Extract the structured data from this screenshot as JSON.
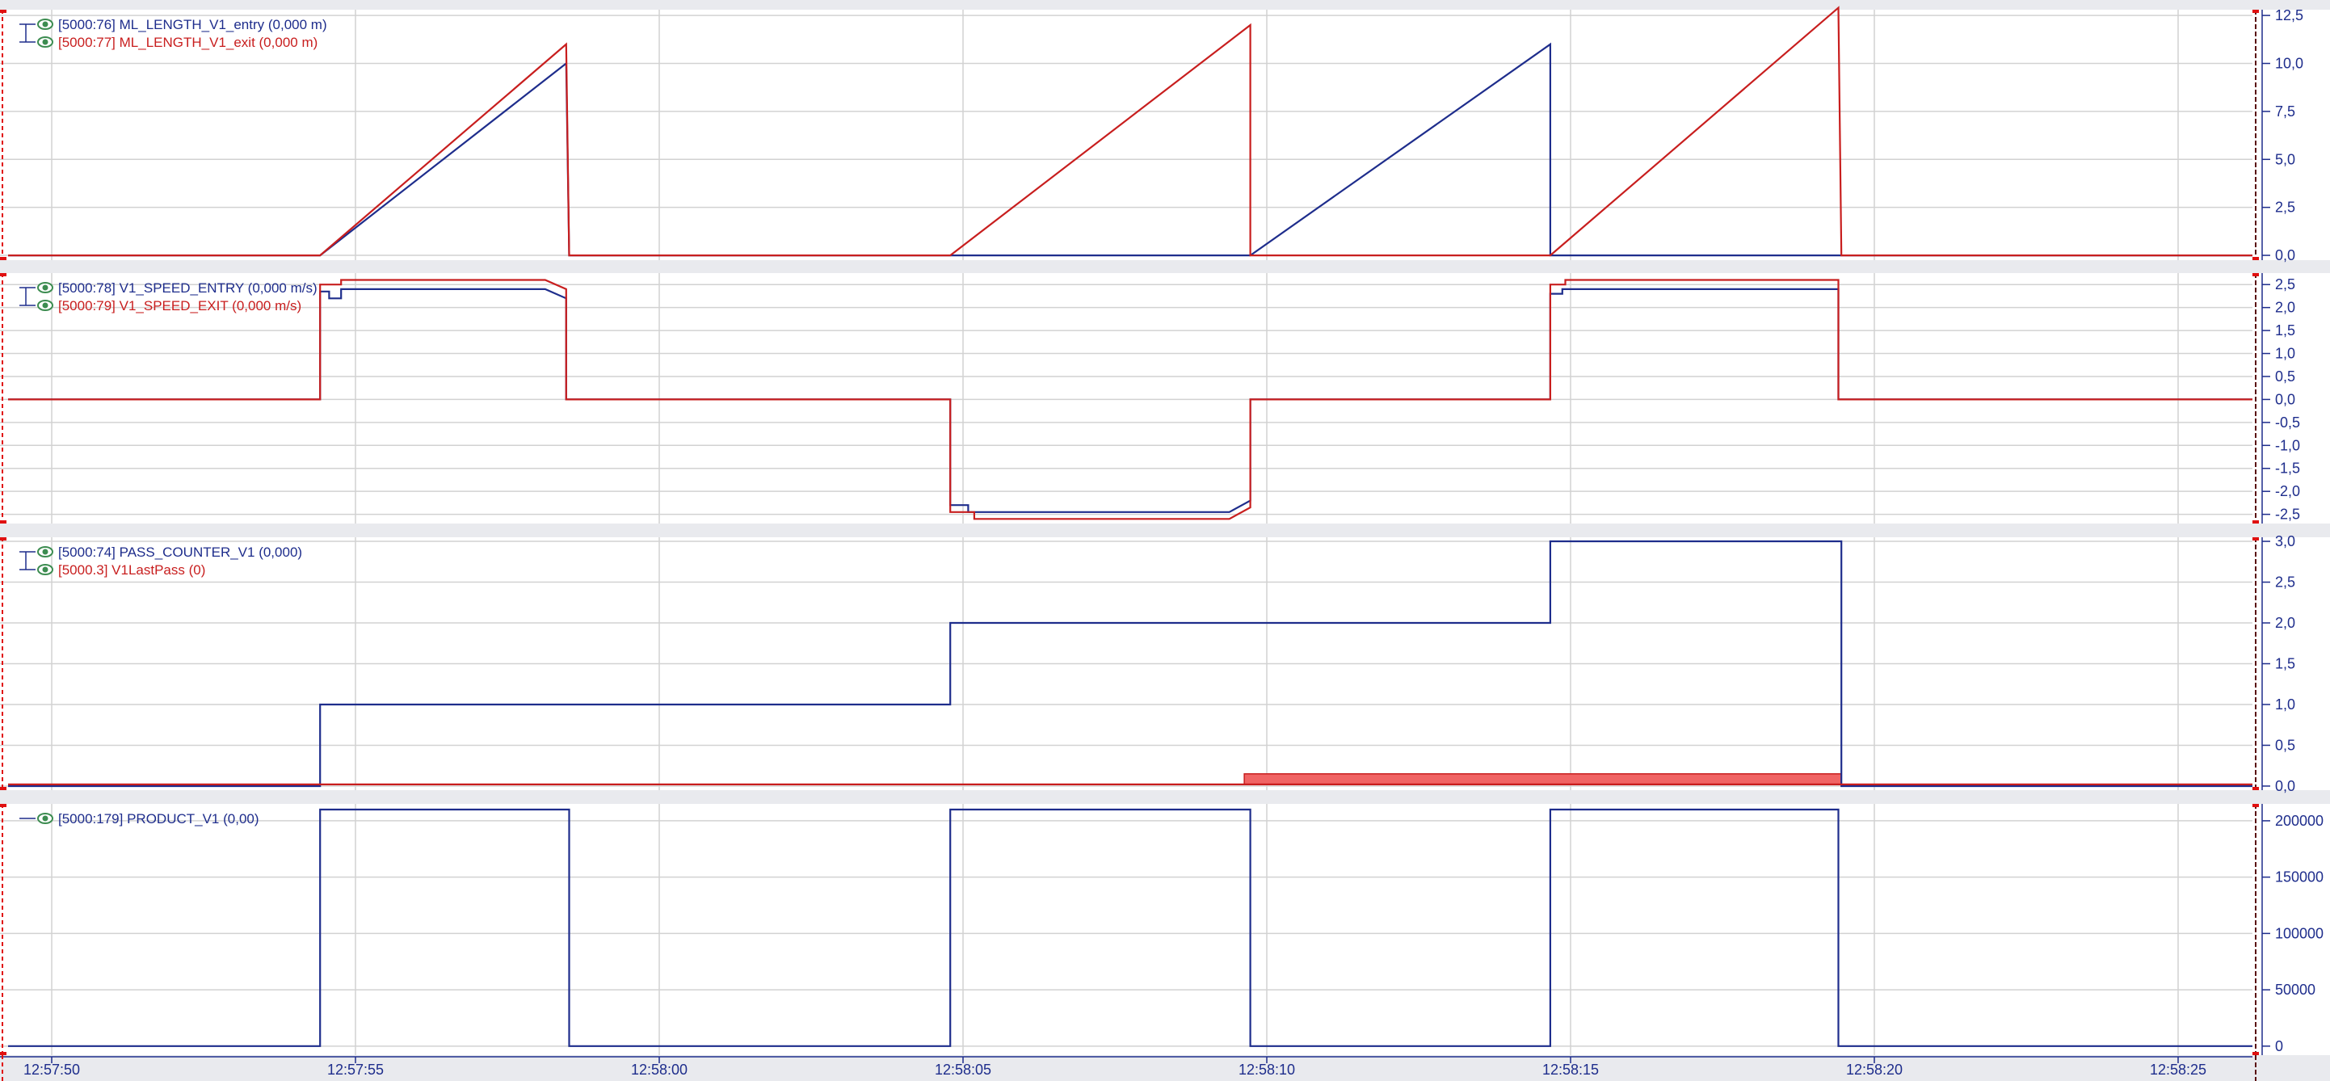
{
  "colors": {
    "background": "#e9eaee",
    "plot_background": "#ffffff",
    "grid": "#d2d2d2",
    "blue_series": "#1e2d8c",
    "red_series": "#c81e1e",
    "red_fill": "#f06464",
    "cursor": "#e01010",
    "legend_eye": "#3c8c50"
  },
  "time_axis": {
    "ticks": [
      "12:57:50",
      "12:57:55",
      "12:58:00",
      "12:58:05",
      "12:58:10",
      "12:58:15",
      "12:58:20",
      "12:58:25"
    ]
  },
  "chart_data": [
    {
      "type": "line",
      "x_unit": "seconds since 12:57:50",
      "xlim": [
        -0.75,
        36.65
      ],
      "ylim": [
        -0.25,
        12.8
      ],
      "y_ticks": [
        "12,5",
        "10,0",
        "7,5",
        "5,0",
        "2,5",
        "0,0"
      ],
      "y_tick_values": [
        12.5,
        10.0,
        7.5,
        5.0,
        2.5,
        0.0
      ],
      "grid": true,
      "legend": "top-left",
      "series": [
        {
          "name": "[5000:76] ML_LENGTH_V1_entry (0,000 m)",
          "color": "blue",
          "x": [
            -0.75,
            4.45,
            8.55,
            8.6,
            19.95,
            19.95,
            24.95,
            24.95,
            34.75,
            34.75,
            36.65
          ],
          "y": [
            0,
            0,
            10.0,
            0,
            0,
            0,
            11.0,
            0,
            0,
            0,
            0
          ]
        },
        {
          "name": "[5000:77] ML_LENGTH_V1_exit (0,000 m)",
          "color": "red",
          "x": [
            -0.75,
            4.45,
            8.55,
            8.6,
            14.95,
            19.95,
            19.95,
            24.95,
            29.75,
            29.8,
            36.65
          ],
          "y": [
            0,
            0,
            11.0,
            0,
            0,
            12.0,
            0,
            0,
            12.9,
            0,
            0
          ]
        }
      ]
    },
    {
      "type": "line",
      "xlim": [
        -0.75,
        36.65
      ],
      "ylim": [
        -2.7,
        2.75
      ],
      "y_ticks": [
        "2,5",
        "2,0",
        "1,5",
        "1,0",
        "0,5",
        "0,0",
        "-0,5",
        "-1,0",
        "-1,5",
        "-2,0",
        "-2,5"
      ],
      "y_tick_values": [
        2.5,
        2.0,
        1.5,
        1.0,
        0.5,
        0.0,
        -0.5,
        -1.0,
        -1.5,
        -2.0,
        -2.5
      ],
      "grid": true,
      "legend": "top-left",
      "series": [
        {
          "name": "[5000:78] V1_SPEED_ENTRY (0,000 m/s)",
          "color": "blue",
          "x": [
            -0.75,
            4.45,
            4.45,
            4.6,
            4.6,
            4.8,
            4.8,
            8.2,
            8.55,
            8.55,
            14.95,
            14.95,
            15.25,
            15.25,
            19.6,
            19.95,
            19.95,
            24.95,
            24.95,
            25.15,
            25.15,
            29.75,
            29.75,
            36.65
          ],
          "y": [
            0,
            0,
            2.35,
            2.35,
            2.2,
            2.2,
            2.4,
            2.4,
            2.2,
            0,
            0,
            -2.3,
            -2.3,
            -2.45,
            -2.45,
            -2.2,
            0,
            0,
            2.3,
            2.3,
            2.4,
            2.4,
            0,
            0
          ]
        },
        {
          "name": "[5000:79] V1_SPEED_EXIT (0,000 m/s)",
          "color": "red",
          "x": [
            -0.75,
            4.45,
            4.45,
            4.8,
            4.8,
            8.2,
            8.55,
            8.55,
            14.95,
            14.95,
            15.35,
            15.35,
            19.6,
            19.95,
            19.95,
            24.95,
            24.95,
            25.2,
            25.2,
            29.75,
            29.75,
            36.65
          ],
          "y": [
            0,
            0,
            2.5,
            2.5,
            2.6,
            2.6,
            2.4,
            0,
            0,
            -2.45,
            -2.45,
            -2.6,
            -2.6,
            -2.35,
            0,
            0,
            2.5,
            2.5,
            2.6,
            2.6,
            0,
            0
          ]
        }
      ]
    },
    {
      "type": "line",
      "xlim": [
        -0.75,
        36.65
      ],
      "ylim": [
        -0.05,
        3.05
      ],
      "y_ticks": [
        "3,0",
        "2,5",
        "2,0",
        "1,5",
        "1,0",
        "0,5",
        "0,0"
      ],
      "y_tick_values": [
        3.0,
        2.5,
        2.0,
        1.5,
        1.0,
        0.5,
        0.0
      ],
      "grid": true,
      "legend": "top-left",
      "fill_band": {
        "series": "red",
        "x_start": 19.85,
        "x_end": 29.8,
        "y_low": 0.02,
        "y_high": 0.15
      },
      "series": [
        {
          "name": "[5000:74] PASS_COUNTER_V1 (0,000)",
          "color": "blue",
          "x": [
            -0.75,
            4.45,
            4.45,
            14.95,
            14.95,
            24.95,
            24.95,
            29.8,
            29.8,
            36.65
          ],
          "y": [
            0,
            0,
            1,
            1,
            2,
            2,
            3,
            3,
            0,
            0
          ]
        },
        {
          "name": "[5000.3] V1LastPass (0)",
          "color": "red",
          "x": [
            -0.75,
            36.65
          ],
          "y": [
            0.02,
            0.02
          ]
        }
      ]
    },
    {
      "type": "line",
      "xlim": [
        -0.75,
        36.65
      ],
      "ylim": [
        -8000,
        215000
      ],
      "y_ticks": [
        "200000",
        "150000",
        "100000",
        "50000",
        "0"
      ],
      "y_tick_values": [
        200000,
        150000,
        100000,
        50000,
        0
      ],
      "grid": true,
      "legend": "top-left",
      "series": [
        {
          "name": "[5000:179] PRODUCT_V1 (0,00)",
          "color": "blue",
          "x": [
            -0.75,
            4.45,
            4.45,
            8.6,
            8.6,
            14.95,
            14.95,
            19.95,
            19.95,
            24.95,
            24.95,
            29.75,
            29.75,
            36.65
          ],
          "y": [
            0,
            0,
            210000,
            210000,
            0,
            0,
            210000,
            210000,
            0,
            0,
            210000,
            210000,
            0,
            0
          ]
        }
      ]
    }
  ]
}
